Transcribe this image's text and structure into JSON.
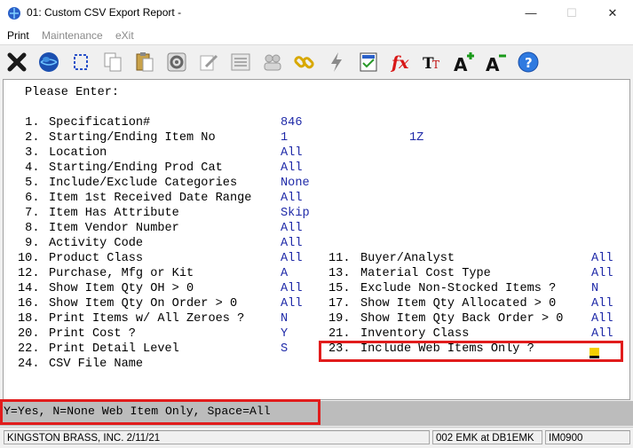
{
  "window": {
    "title": "01: Custom CSV Export Report -",
    "min": "—",
    "max": "☐",
    "close": "✕"
  },
  "menu": [
    "Print",
    "Maintenance",
    "eXit"
  ],
  "toolbar": [
    "close-icon",
    "globe-icon",
    "select-icon",
    "copy-icon",
    "paste-icon",
    "settings-icon",
    "edit-icon",
    "list-icon",
    "users-icon",
    "link-icon",
    "lightning-icon",
    "calculator-icon",
    "function-icon",
    "font-size-icon",
    "font-increase-icon",
    "font-decrease-icon",
    "help-icon"
  ],
  "form": {
    "prompt": "Please Enter:",
    "fields": [
      {
        "num": " 1.",
        "label": "Specification#",
        "value": "846"
      },
      {
        "num": " 2.",
        "label": "Starting/Ending Item No",
        "value": "1",
        "value2": "1Z"
      },
      {
        "num": " 3.",
        "label": "Location",
        "value": "All"
      },
      {
        "num": " 4.",
        "label": "Starting/Ending Prod Cat",
        "value": "All"
      },
      {
        "num": " 5.",
        "label": "Include/Exclude Categories",
        "value": "None"
      },
      {
        "num": " 6.",
        "label": "Item 1st Received Date Range",
        "value": "All"
      },
      {
        "num": " 7.",
        "label": "Item Has Attribute",
        "value": "Skip"
      },
      {
        "num": " 8.",
        "label": "Item Vendor Number",
        "value": "All"
      },
      {
        "num": " 9.",
        "label": "Activity Code",
        "value": "All"
      },
      {
        "num": "10.",
        "label": "Product Class",
        "value": "All"
      },
      {
        "num": "12.",
        "label": "Purchase, Mfg or Kit",
        "value": "A"
      },
      {
        "num": "14.",
        "label": "Show Item Qty OH > 0",
        "value": "All"
      },
      {
        "num": "16.",
        "label": "Show Item Qty On Order > 0",
        "value": "All"
      },
      {
        "num": "18.",
        "label": "Print Items w/ All Zeroes ?",
        "value": "N"
      },
      {
        "num": "20.",
        "label": "Print Cost ?",
        "value": "Y"
      },
      {
        "num": "22.",
        "label": "Print Detail Level",
        "value": "S"
      },
      {
        "num": "24.",
        "label": "CSV File Name",
        "value": ""
      }
    ],
    "right_fields": [
      {
        "num": "11.",
        "label": "Buyer/Analyst",
        "value": "All"
      },
      {
        "num": "13.",
        "label": "Material Cost Type",
        "value": "All"
      },
      {
        "num": "15.",
        "label": "Exclude Non-Stocked Items ?",
        "value": "N"
      },
      {
        "num": "17.",
        "label": "Show Item Qty Allocated > 0",
        "value": "All"
      },
      {
        "num": "19.",
        "label": "Show Item Qty Back Order > 0",
        "value": "All"
      },
      {
        "num": "21.",
        "label": "Inventory Class",
        "value": "All"
      },
      {
        "num": "23.",
        "label": "Include Web Items Only ?",
        "value": ""
      }
    ]
  },
  "help_text": "Y=Yes, N=None Web Item Only, Space=All",
  "status": {
    "company": "KINGSTON BRASS, INC. 2/11/21",
    "session": "002 EMK at DB1EMK",
    "program": "IM0900"
  }
}
